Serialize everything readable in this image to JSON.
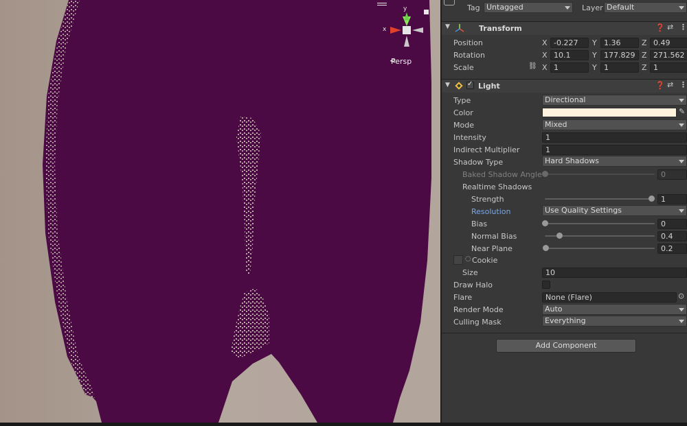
{
  "scene": {
    "projection_label": "Persp",
    "gizmo_axis_x": "x",
    "gizmo_axis_y": "y"
  },
  "header": {
    "tag_label": "Tag",
    "tag_value": "Untagged",
    "layer_label": "Layer",
    "layer_value": "Default"
  },
  "transform": {
    "title": "Transform",
    "position_label": "Position",
    "rotation_label": "Rotation",
    "scale_label": "Scale",
    "axis_x": "X",
    "axis_y": "Y",
    "axis_z": "Z",
    "position": {
      "x": "-0.227",
      "y": "1.36",
      "z": "0.49"
    },
    "rotation": {
      "x": "10.1",
      "y": "177.829",
      "z": "271.562"
    },
    "scale": {
      "x": "1",
      "y": "1",
      "z": "1"
    }
  },
  "light": {
    "title": "Light",
    "type_label": "Type",
    "type_value": "Directional",
    "color_label": "Color",
    "color_value": "#fff3dd",
    "mode_label": "Mode",
    "mode_value": "Mixed",
    "intensity_label": "Intensity",
    "intensity_value": "1",
    "indirect_label": "Indirect Multiplier",
    "indirect_value": "1",
    "shadow_type_label": "Shadow Type",
    "shadow_type_value": "Hard Shadows",
    "baked_angle_label": "Baked Shadow Angle",
    "baked_angle_value": "0",
    "realtime_label": "Realtime Shadows",
    "strength_label": "Strength",
    "strength_value": "1",
    "resolution_label": "Resolution",
    "resolution_value": "Use Quality Settings",
    "bias_label": "Bias",
    "bias_value": "0",
    "normal_bias_label": "Normal Bias",
    "normal_bias_value": "0.4",
    "near_plane_label": "Near Plane",
    "near_plane_value": "0.2",
    "cookie_label": "Cookie",
    "size_label": "Size",
    "size_value": "10",
    "draw_halo_label": "Draw Halo",
    "flare_label": "Flare",
    "flare_value": "None (Flare)",
    "render_mode_label": "Render Mode",
    "render_mode_value": "Auto",
    "culling_mask_label": "Culling Mask",
    "culling_mask_value": "Everything"
  },
  "add_component_label": "Add Component",
  "colors": {
    "scene_bg": "#a8998f",
    "silhouette": "#4c0a45",
    "accent_blue": "#7ba7e6"
  }
}
